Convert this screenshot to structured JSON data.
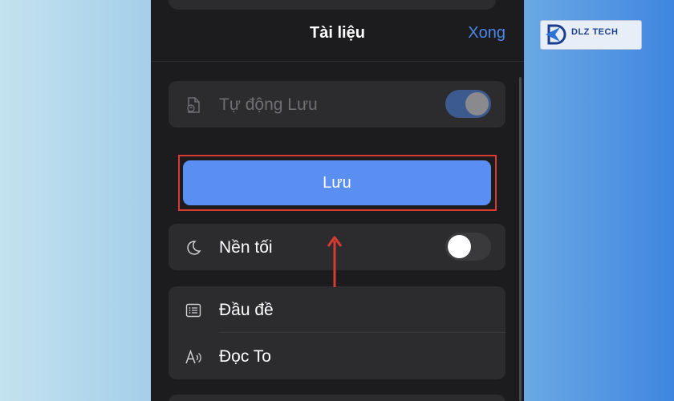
{
  "header": {
    "title": "Tài liệu",
    "done_label": "Xong"
  },
  "autosave": {
    "label": "Tự động Lưu",
    "icon": "autosave-document-icon",
    "enabled": true
  },
  "save_button": {
    "label": "Lưu"
  },
  "dark_mode": {
    "label": "Nền tối",
    "icon": "moon-icon",
    "enabled": false
  },
  "list": [
    {
      "label": "Đầu đề",
      "icon": "list-icon"
    },
    {
      "label": "Đọc To",
      "icon": "read-aloud-icon"
    }
  ],
  "logo": {
    "text": "DLZ TECH"
  },
  "colors": {
    "accent": "#4e86e8",
    "button": "#5a8ef0",
    "highlight": "#d83a34"
  }
}
